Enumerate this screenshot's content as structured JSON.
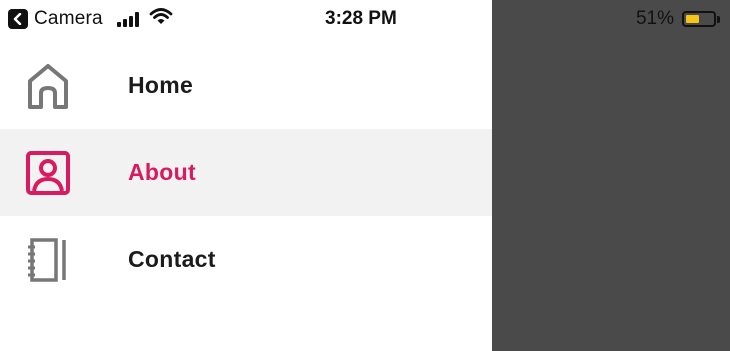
{
  "status_bar": {
    "back_label": "Camera",
    "time": "3:28 PM",
    "battery_percent": "51%",
    "battery_level": 0.51,
    "battery_color": "#f5c518"
  },
  "menu": {
    "items": [
      {
        "label": "Home",
        "icon": "home-icon",
        "active": false
      },
      {
        "label": "About",
        "icon": "person-icon",
        "active": true
      },
      {
        "label": "Contact",
        "icon": "notebook-icon",
        "active": false
      }
    ]
  },
  "colors": {
    "accent": "#d81b60",
    "overlay": "#4a4a4a",
    "active_row": "#f2f2f2",
    "icon_default": "#777777"
  }
}
